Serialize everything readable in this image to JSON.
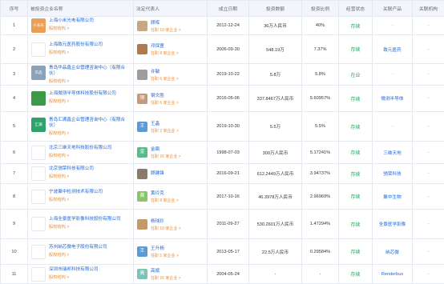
{
  "headers": {
    "index": "序号",
    "company": "被投资企业名称",
    "legal_rep": "法定代表人",
    "est_date": "成立日期",
    "investment": "投资数额",
    "ratio": "投资比例",
    "status": "经营状态",
    "product": "关联产品",
    "org": "关联机构"
  },
  "rows": [
    {
      "idx": "1",
      "logo_text": "小米光电",
      "logo_color": "#e8a058",
      "name": "上海小米光电有限公司",
      "equity": "股权结构 >",
      "rep_avatar": "",
      "rep_avatar_color": "#c7a884",
      "rep": "顾晖",
      "rep_sub": "任职 10 家企业 >",
      "date": "2012-12-24",
      "amount": "36万人民币",
      "pct": "40%",
      "status": "存续",
      "product": "-",
      "org": "-"
    },
    {
      "idx": "2",
      "logo_text": "",
      "logo_color": "#ffffff",
      "name": "上海致元医药股份有限公司",
      "equity": "股权结构 >",
      "rep_avatar": "",
      "rep_avatar_color": "#b07a4a",
      "rep": "邓保童",
      "rep_sub": "任职 8 家企业 >",
      "date": "2006-09-30",
      "amount": "548.19万",
      "pct": "7.37%",
      "status": "存续",
      "product": "致元医药",
      "org": "-"
    },
    {
      "idx": "3",
      "logo_text": "华品",
      "logo_color": "#8aa3b8",
      "name": "青岛华品鑫企业管理咨询中心（有限合伙）",
      "equity": "股权结构 >",
      "rep_avatar": "",
      "rep_avatar_color": "#9d9d9d",
      "rep": "许敏",
      "rep_sub": "任职 6 家企业 >",
      "date": "2019-10-22",
      "amount": "5.8万",
      "pct": "5.8%",
      "status": "在业",
      "product": "-",
      "org": "-"
    },
    {
      "idx": "4",
      "logo_text": "",
      "logo_color": "#3a9a48",
      "name": "上海微测半导体科技股份有限公司",
      "equity": "股权结构 >",
      "rep_avatar": "钢",
      "rep_avatar_color": "#c49a7a",
      "rep": "钢文胜",
      "rep_sub": "任职 5 家企业 >",
      "date": "2016-05-06",
      "amount": "337.8467万人民币",
      "pct": "5.60957%",
      "status": "存续",
      "product": "微测半导体",
      "org": "-"
    },
    {
      "idx": "5",
      "logo_text": "汇满",
      "logo_color": "#2fa36b",
      "name": "青岛汇满鑫企业管理咨询中心（有限合伙）",
      "equity": "股权结构 >",
      "rep_avatar": "王",
      "rep_avatar_color": "#5b9bd5",
      "rep": "王晶",
      "rep_sub": "任职 2 家企业 >",
      "date": "2019-10-30",
      "amount": "5.5万",
      "pct": "5.5%",
      "status": "存续",
      "product": "-",
      "org": "-"
    },
    {
      "idx": "6",
      "logo_text": "",
      "logo_color": "#ffffff",
      "name": "北京三继天地科技股份有限公司",
      "equity": "股权结构 >",
      "rep_avatar": "金",
      "rep_avatar_color": "#5bb98c",
      "rep": "金飙",
      "rep_sub": "任职 16 家企业 >",
      "date": "1998-07-03",
      "amount": "300万人民币",
      "pct": "5.17241%",
      "status": "存续",
      "product": "三维天地",
      "org": "-"
    },
    {
      "idx": "7",
      "logo_text": "",
      "logo_color": "#ffffff",
      "name": "北京驰荣科技有限公司",
      "equity": "股权结构 >",
      "rep_avatar": "",
      "rep_avatar_color": "#8c7b6b",
      "rep": "顾建锋",
      "rep_sub": "",
      "date": "2016-09-21",
      "amount": "612.2449万人民币",
      "pct": "3.94737%",
      "status": "存续",
      "product": "驰荣科技",
      "org": "-"
    },
    {
      "idx": "8",
      "logo_text": "",
      "logo_color": "#ffffff",
      "name": "宁波聚中检测技术有限公司",
      "equity": "股权结构 >",
      "rep_avatar": "黄",
      "rep_avatar_color": "#8bc36a",
      "rep": "黄玲克",
      "rep_sub": "任职 8 家企业 >",
      "date": "2017-10-16",
      "amount": "46.3978万人民币",
      "pct": "2.96969%",
      "status": "存续",
      "product": "聚中生物",
      "org": "-"
    },
    {
      "idx": "9",
      "logo_text": "",
      "logo_color": "#ffffff",
      "name": "上海全景医学影像科技股份有限公司",
      "equity": "股权结构 >",
      "rep_avatar": "",
      "rep_avatar_color": "#c39a6a",
      "rep": "杨球珍",
      "rep_sub": "任职 10 家企业 >",
      "date": "2011-09-27",
      "amount": "530.2601万人民币",
      "pct": "1.47294%",
      "status": "存续",
      "product": "全景医学影像",
      "org": "-"
    },
    {
      "idx": "10",
      "logo_text": "",
      "logo_color": "#ffffff",
      "name": "苏州納芯微电子股份有限公司",
      "equity": "股权结构 >",
      "rep_avatar": "王",
      "rep_avatar_color": "#5b9bd5",
      "rep": "王升杨",
      "rep_sub": "任职 5 家企业 >",
      "date": "2013-05-17",
      "amount": "22.5万人民币",
      "pct": "0.29584%",
      "status": "存续",
      "product": "纳芯微",
      "org": "-"
    },
    {
      "idx": "11",
      "logo_text": "",
      "logo_color": "#ffffff",
      "name": "深圳市瑞邦科技有限公司",
      "equity": "股权结构 >",
      "rep_avatar": "高",
      "rep_avatar_color": "#7cc5b5",
      "rep": "高斌",
      "rep_sub": "任职 16 家企业 >",
      "date": "2004-05-24",
      "amount": "-",
      "pct": "-",
      "status": "存续",
      "product": "Renderbus",
      "org": "-"
    }
  ]
}
